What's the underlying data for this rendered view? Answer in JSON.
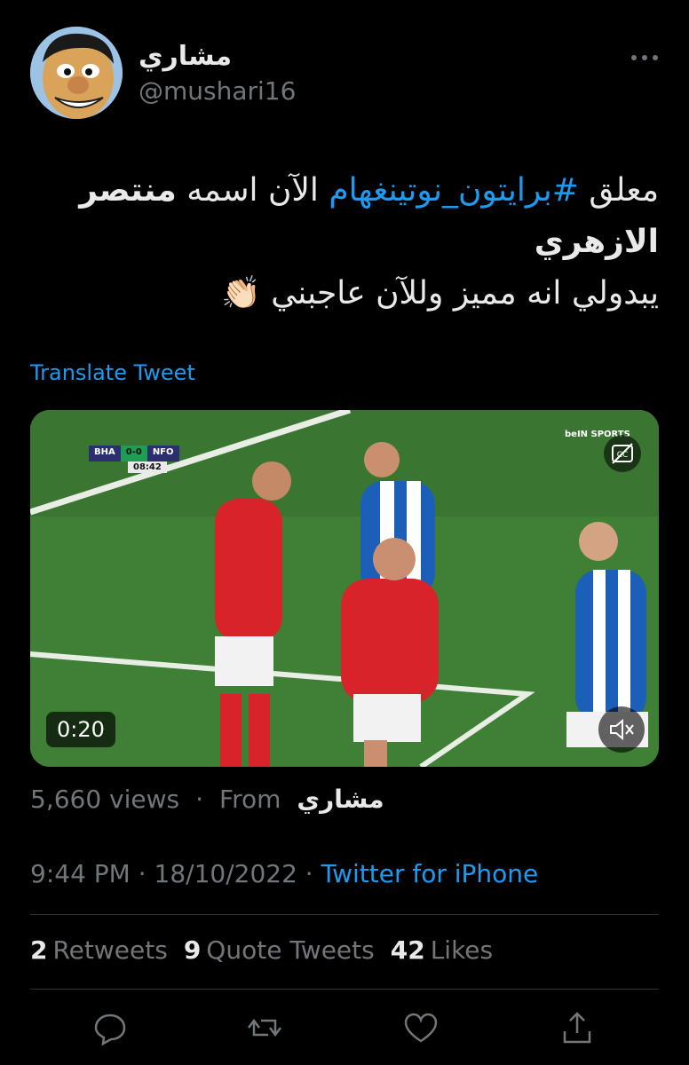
{
  "user": {
    "display_name": "مشاري",
    "handle": "@mushari16"
  },
  "tweet": {
    "prefix": "معلق ",
    "hashtag": "#برايتون_نوتينغهام",
    "middle": " الآن اسمه ",
    "bold_name": "منتصر الازهري",
    "line2": "يبدولي انه مميز وللآن عاجبني 👏🏻",
    "translate_label": "Translate Tweet"
  },
  "video": {
    "duration": "0:20",
    "score_home": "BHA",
    "score": "0-0",
    "score_away": "NFO",
    "clock": "08:42",
    "broadcaster": "beIN SPORTS"
  },
  "meta": {
    "views": "5,660 views",
    "separator": "·",
    "from_label": "From",
    "source_name": "مشاري",
    "time": "9:44 PM · 18/10/2022 · ",
    "client": "Twitter for iPhone"
  },
  "stats": {
    "retweets_count": "2",
    "retweets_label": "Retweets",
    "quotes_count": "9",
    "quotes_label": "Quote Tweets",
    "likes_count": "42",
    "likes_label": "Likes"
  },
  "icons": [
    "more-icon",
    "reply-icon",
    "retweet-icon",
    "like-icon",
    "share-icon",
    "captions-icon",
    "mute-icon"
  ],
  "colors": {
    "background": "#000000",
    "text": "#e7e9ea",
    "muted": "#71767b",
    "accent": "#1d9bf0",
    "divider": "#2f3336"
  }
}
